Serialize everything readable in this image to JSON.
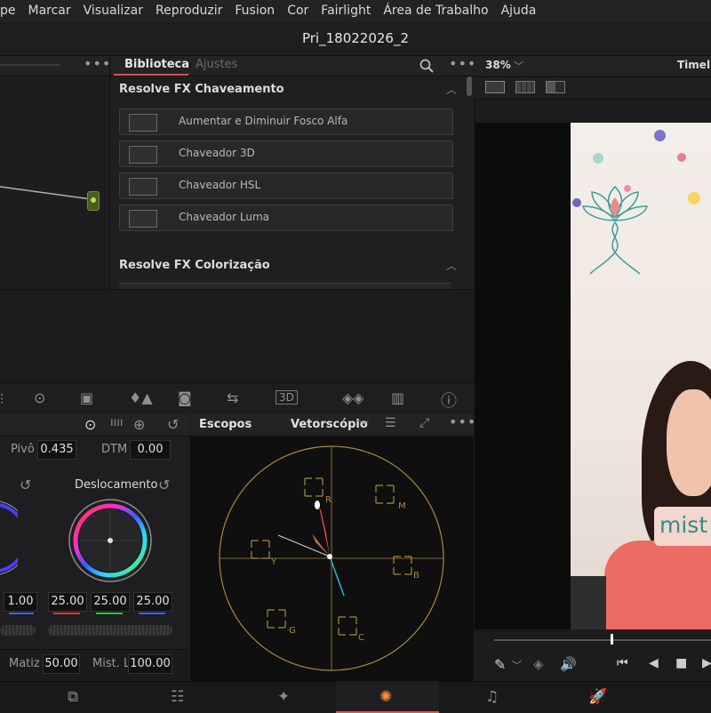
{
  "menubar": {
    "items": [
      "pe",
      "Marcar",
      "Visualizar",
      "Reproduzir",
      "Fusion",
      "Cor",
      "Fairlight",
      "Área de Trabalho",
      "Ajuda"
    ]
  },
  "project": {
    "title": "Pri_18022026_2"
  },
  "library": {
    "tab_active": "Biblioteca",
    "tab_inactive": "Ajustes",
    "section1": "Resolve FX Chaveamento",
    "items": [
      "Aumentar e Diminuir Fosco Alfa",
      "Chaveador 3D",
      "Chaveador HSL",
      "Chaveador Luma"
    ],
    "section2": "Resolve FX Colorização"
  },
  "viewer": {
    "zoom": "38%",
    "timeline_label": "Timeli",
    "caption": "mist"
  },
  "color": {
    "pivo_label": "Pivô",
    "pivo_value": "0.435",
    "dtm_label": "DTM",
    "dtm_value": "0.00",
    "wheel_title": "Deslocamento",
    "left_value": "1.00",
    "offset_values": [
      "25.00",
      "25.00",
      "25.00"
    ],
    "matiz_label": "Matiz",
    "matiz_value": "50.00",
    "mistl_label": "Mist. L",
    "mistl_value": "100.00"
  },
  "scopes": {
    "title": "Escopos",
    "mode": "Vetorscópio",
    "targets": [
      "R",
      "M",
      "B",
      "C",
      "G",
      "Y"
    ]
  },
  "colors": {
    "accent": "#e8553b",
    "lib_underline": "#d9534f"
  }
}
